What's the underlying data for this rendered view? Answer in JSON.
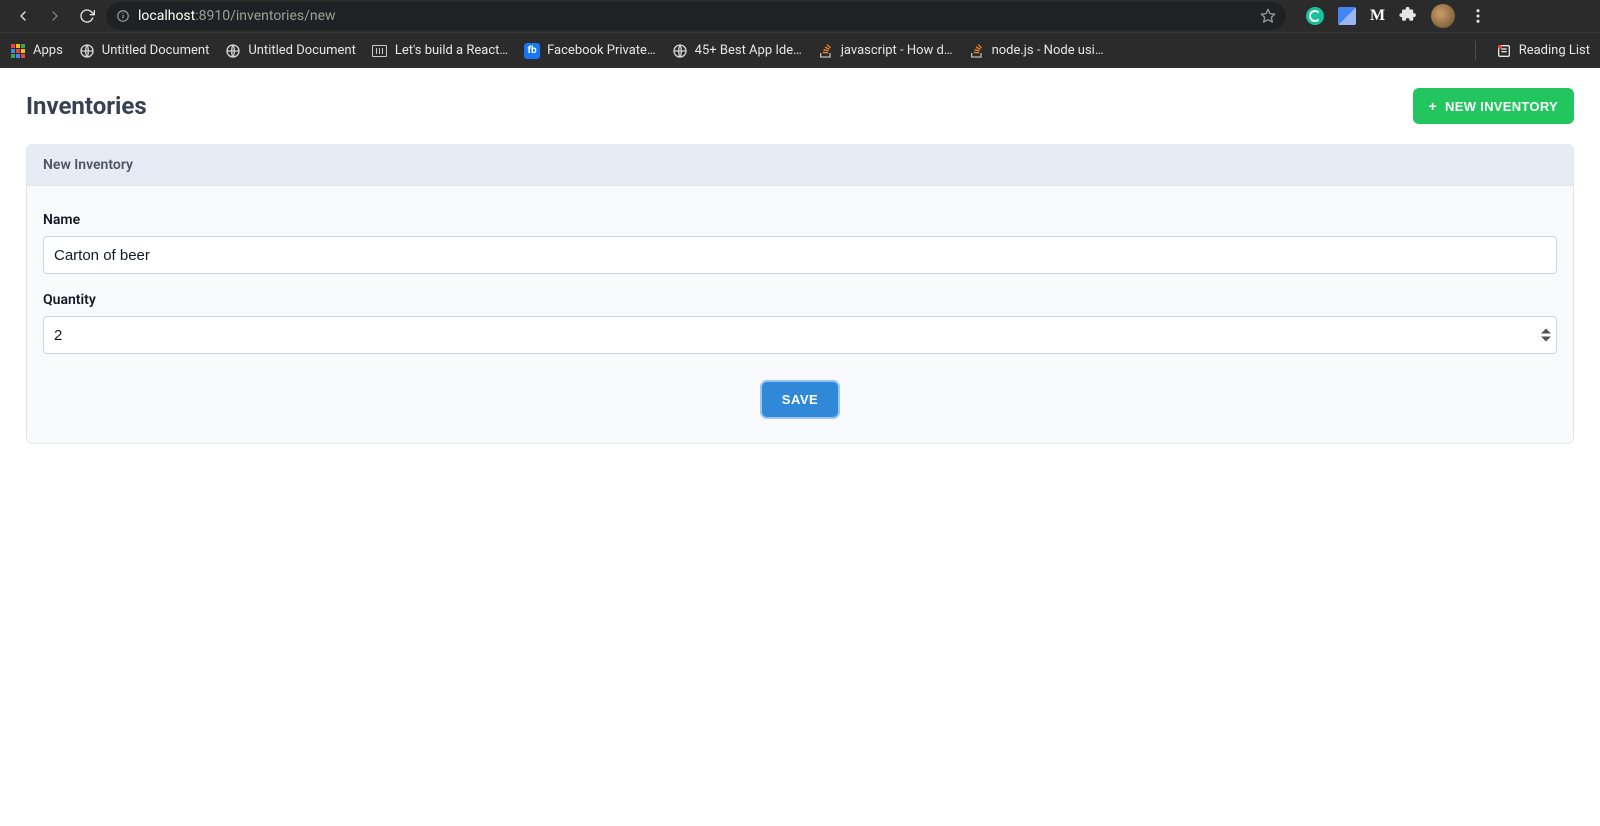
{
  "browser": {
    "url_host": "localhost",
    "url_path": ":8910/inventories/new"
  },
  "bookmarks": {
    "apps": "Apps",
    "items": [
      "Untitled Document",
      "Untitled Document",
      "Let's build a React…",
      "Facebook Private…",
      "45+ Best App Ide…",
      "javascript - How d…",
      "node.js - Node usi…"
    ],
    "reading_list": "Reading List"
  },
  "page": {
    "title": "Inventories",
    "new_button": "NEW INVENTORY",
    "card_title": "New Inventory",
    "form": {
      "name_label": "Name",
      "name_value": "Carton of beer",
      "quantity_label": "Quantity",
      "quantity_value": "2",
      "save_label": "SAVE"
    }
  }
}
